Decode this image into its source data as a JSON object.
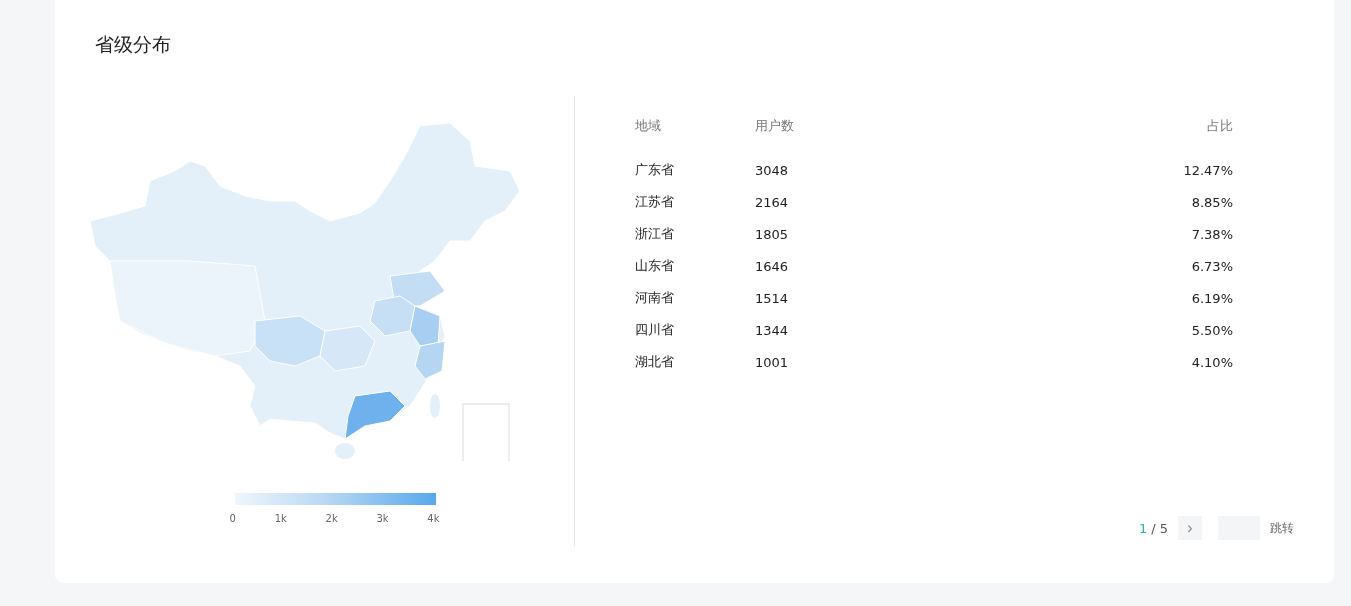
{
  "card": {
    "title": "省级分布"
  },
  "legend": {
    "ticks": [
      "0",
      "1k",
      "2k",
      "3k",
      "4k"
    ]
  },
  "table": {
    "columns": [
      "地域",
      "用户数",
      "占比"
    ],
    "rows": [
      {
        "region": "广东省",
        "users": "3048",
        "share": "12.47%"
      },
      {
        "region": "江苏省",
        "users": "2164",
        "share": "8.85%"
      },
      {
        "region": "浙江省",
        "users": "1805",
        "share": "7.38%"
      },
      {
        "region": "山东省",
        "users": "1646",
        "share": "6.73%"
      },
      {
        "region": "河南省",
        "users": "1514",
        "share": "6.19%"
      },
      {
        "region": "四川省",
        "users": "1344",
        "share": "5.50%"
      },
      {
        "region": "湖北省",
        "users": "1001",
        "share": "4.10%"
      }
    ]
  },
  "pagination": {
    "current": "1",
    "total": "/ 5",
    "next": "›",
    "jump_label": "跳转"
  }
}
